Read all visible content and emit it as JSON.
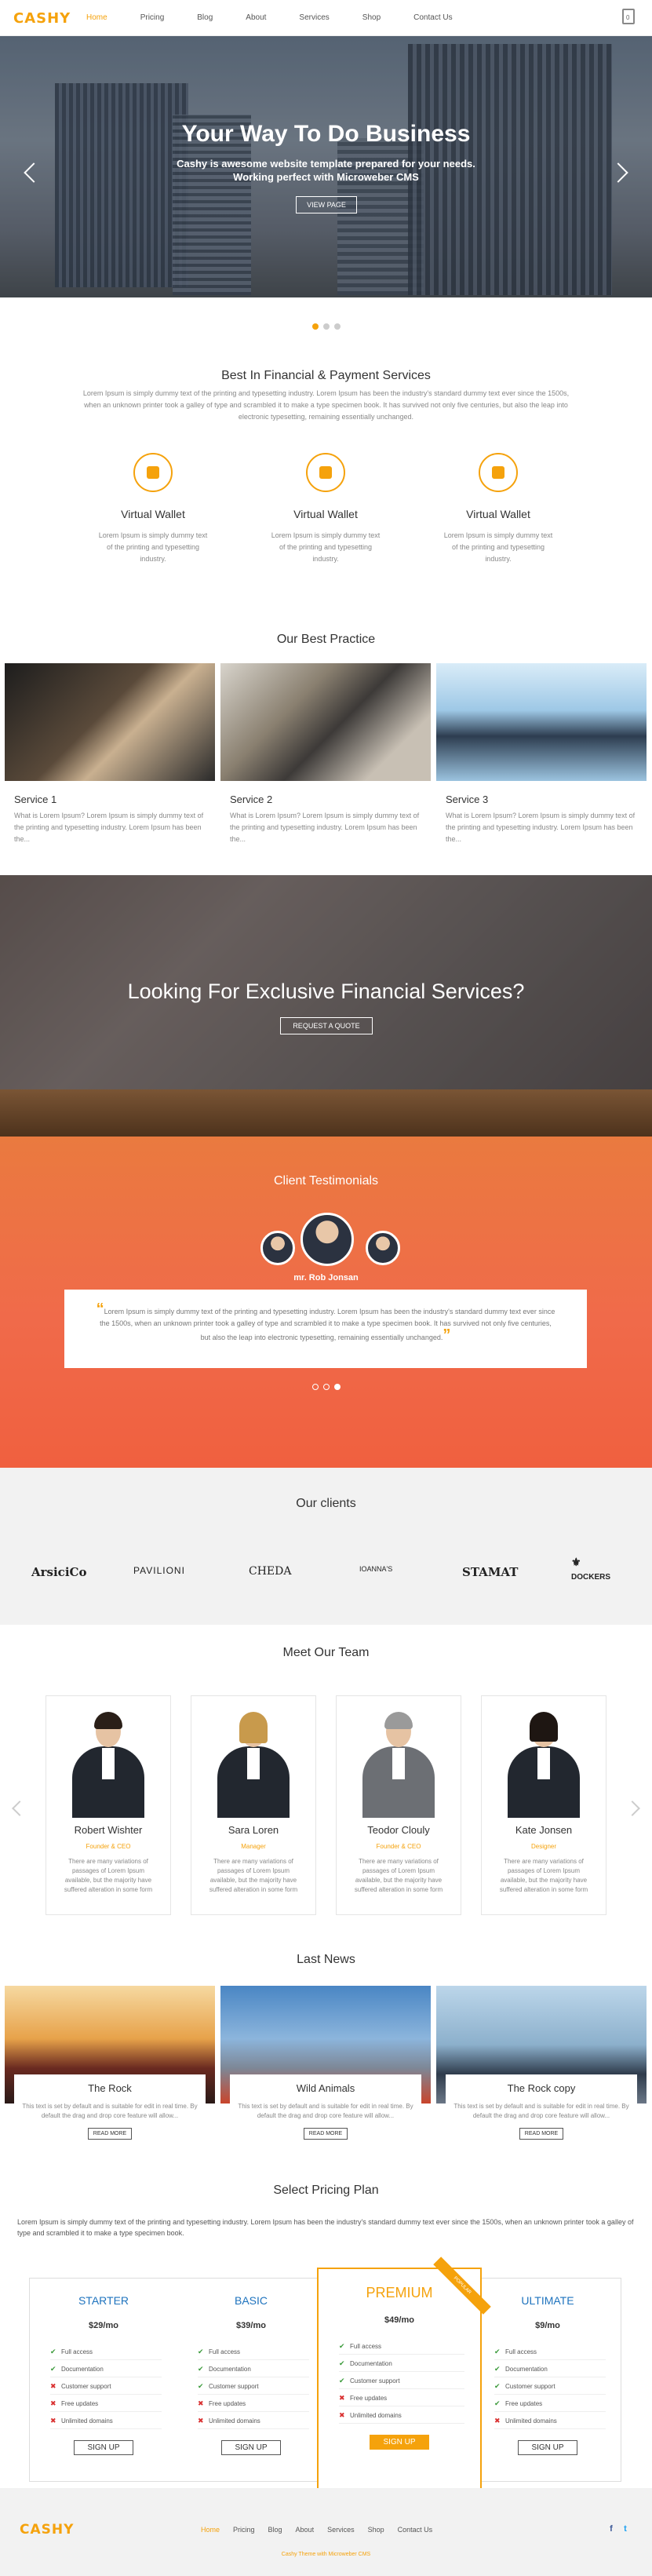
{
  "header": {
    "logo": "CASHY",
    "nav": [
      "Home",
      "Pricing",
      "Blog",
      "About",
      "Services",
      "Shop",
      "Contact Us"
    ],
    "cart_count": "0"
  },
  "hero": {
    "title": "Your Way To Do Business",
    "subtitle_line1": "Cashy is awesome website template prepared for your needs.",
    "subtitle_line2": "Working perfect with Microweber CMS",
    "button": "VIEW PAGE"
  },
  "intro": {
    "title": "Best In Financial & Payment Services",
    "text": "Lorem Ipsum is simply dummy text of the printing and typesetting industry. Lorem Ipsum has been the industry's standard dummy text ever since the 1500s, when an unknown printer took a galley of type and scrambled it to make a type specimen book. It has survived not only five centuries, but also the leap into electronic typesetting, remaining essentially unchanged."
  },
  "features": [
    {
      "title": "Virtual Wallet",
      "text": "Lorem Ipsum is simply dummy text of the printing and typesetting industry.",
      "icon": "globe-icon"
    },
    {
      "title": "Virtual Wallet",
      "text": "Lorem Ipsum is simply dummy text of the printing and typesetting industry.",
      "icon": "briefcase-icon"
    },
    {
      "title": "Virtual Wallet",
      "text": "Lorem Ipsum is simply dummy text of the printing and typesetting industry.",
      "icon": "money-icon"
    }
  ],
  "practice": {
    "title": "Our Best Practice",
    "services": [
      {
        "title": "Service 1",
        "text": "What is Lorem Ipsum? Lorem Ipsum is simply dummy text of the printing and typesetting industry. Lorem Ipsum has been the..."
      },
      {
        "title": "Service 2",
        "text": "What is Lorem Ipsum? Lorem Ipsum is simply dummy text of the printing and typesetting industry. Lorem Ipsum has been the..."
      },
      {
        "title": "Service 3",
        "text": "What is Lorem Ipsum? Lorem Ipsum is simply dummy text of the printing and typesetting industry. Lorem Ipsum has been the..."
      }
    ]
  },
  "quote": {
    "title": "Looking For Exclusive Financial Services?",
    "button": "REQUEST A QUOTE"
  },
  "testimonials": {
    "title": "Client Testimonials",
    "name": "mr. Rob Jonsan",
    "text": "Lorem Ipsum is simply dummy text of the printing and typesetting industry. Lorem Ipsum has been the industry's standard dummy text ever since the 1500s, when an unknown printer took a galley of type and scrambled it to make a type specimen book. It has survived not only five centuries, but also the leap into electronic typesetting, remaining essentially unchanged."
  },
  "clients": {
    "title": "Our clients",
    "logos": [
      "ArsiciCo",
      "PAVILIONI",
      "CHEDA",
      "IOANNA'S",
      "STAMAT",
      "DOCKERS"
    ]
  },
  "team": {
    "title": "Meet Our Team",
    "members": [
      {
        "name": "Robert Wishter",
        "role": "Founder & CEO",
        "text": "There are many variations of passages of Lorem Ipsum available, but the majority have suffered alteration in some form"
      },
      {
        "name": "Sara Loren",
        "role": "Manager",
        "text": "There are many variations of passages of Lorem Ipsum available, but the majority have suffered alteration in some form"
      },
      {
        "name": "Teodor Clouly",
        "role": "Founder & CEO",
        "text": "There are many variations of passages of Lorem Ipsum available, but the majority have suffered alteration in some form"
      },
      {
        "name": "Kate Jonsen",
        "role": "Designer",
        "text": "There are many variations of passages of Lorem Ipsum available, but the majority have suffered alteration in some form"
      }
    ]
  },
  "news": {
    "title": "Last News",
    "items": [
      {
        "title": "The Rock",
        "text": "This text is set by default and is suitable for edit in real time. By default the drag and drop core feature will allow...",
        "button": "READ MORE"
      },
      {
        "title": "Wild Animals",
        "text": "This text is set by default and is suitable for edit in real time. By default the drag and drop core feature will allow...",
        "button": "READ MORE"
      },
      {
        "title": "The Rock copy",
        "text": "This text is set by default and is suitable for edit in real time. By default the drag and drop core feature will allow...",
        "button": "READ MORE"
      }
    ]
  },
  "pricing": {
    "title": "Select Pricing Plan",
    "intro": "Lorem Ipsum is simply dummy text of the printing and typesetting industry. Lorem Ipsum has been the industry's standard dummy text ever since the 1500s, when an unknown printer took a galley of type and scrambled it to make a type specimen book.",
    "ribbon": "POPULAR",
    "features": [
      "Full access",
      "Documentation",
      "Customer support",
      "Free updates",
      "Unlimited domains"
    ],
    "plans": [
      {
        "name": "STARTER",
        "price": "$29/mo",
        "button": "SIGN UP"
      },
      {
        "name": "BASIC",
        "price": "$39/mo",
        "button": "SIGN UP"
      },
      {
        "name": "PREMIUM",
        "price": "$49/mo",
        "button": "SIGN UP"
      },
      {
        "name": "ULTIMATE",
        "price": "$9/mo",
        "button": "SIGN UP"
      }
    ]
  },
  "footer": {
    "logo": "CASHY",
    "nav": [
      "Home",
      "Pricing",
      "Blog",
      "About",
      "Services",
      "Shop",
      "Contact Us"
    ],
    "credit": "Cashy Theme with Microweber CMS"
  },
  "colors": {
    "accent": "#f5a20c",
    "testimonial": "#f06a4a",
    "link_blue": "#1e73be"
  }
}
